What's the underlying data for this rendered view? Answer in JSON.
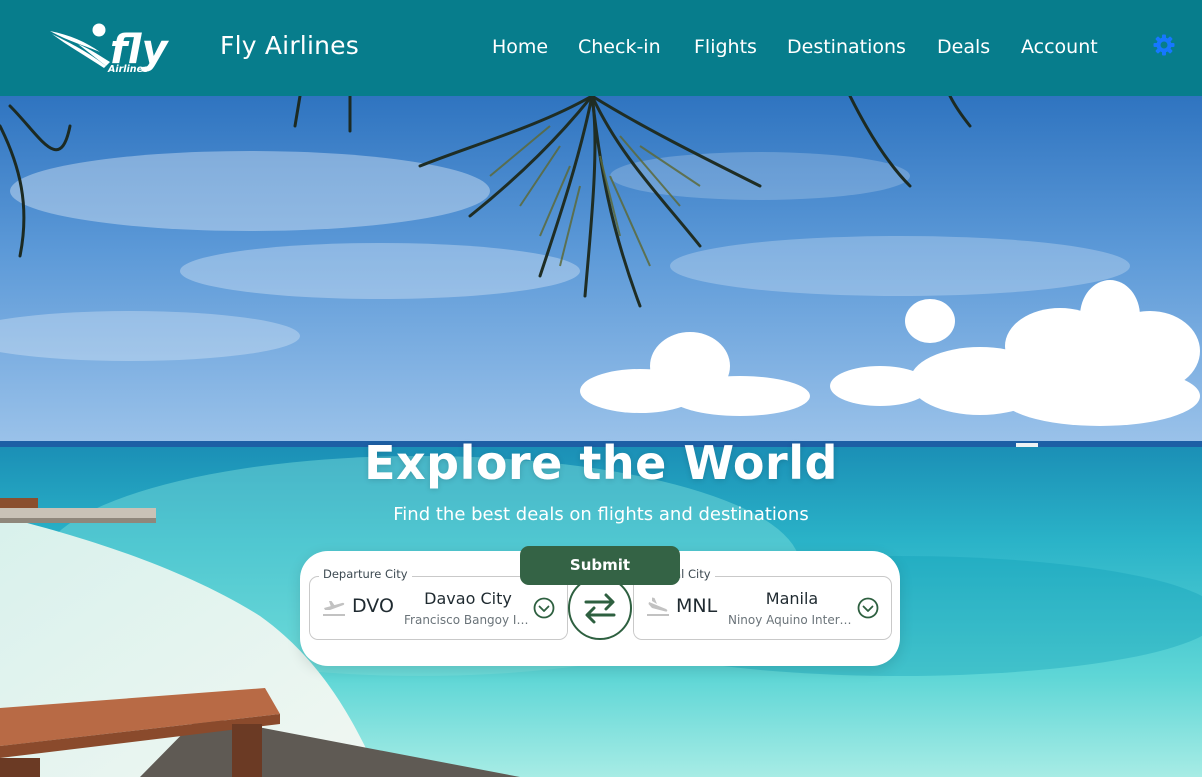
{
  "header": {
    "brand": "Fly Airlines",
    "logo_text": "fly",
    "logo_subtext": "Airlines",
    "background": "#077d8c",
    "nav": [
      {
        "label": "Home"
      },
      {
        "label": "Check-in"
      },
      {
        "label": "Flights"
      },
      {
        "label": "Destinations"
      },
      {
        "label": "Deals"
      },
      {
        "label": "Account"
      }
    ],
    "theme_icon": "gear-icon"
  },
  "hero": {
    "title": "Explore the World",
    "subtitle": "Find the best deals on flights and destinations"
  },
  "search": {
    "departure": {
      "legend": "Departure City",
      "code": "DVO",
      "city": "Davao City",
      "airport": "Francisco Bangoy International Airport",
      "icon": "plane-departure-icon"
    },
    "arrival": {
      "legend": "Arrival City",
      "code": "MNL",
      "city": "Manila",
      "airport": "Ninoy Aquino International Airport",
      "icon": "plane-arrival-icon"
    },
    "swap_icon": "swap-arrows-icon",
    "submit_label": "Submit",
    "accent": "#346345"
  }
}
